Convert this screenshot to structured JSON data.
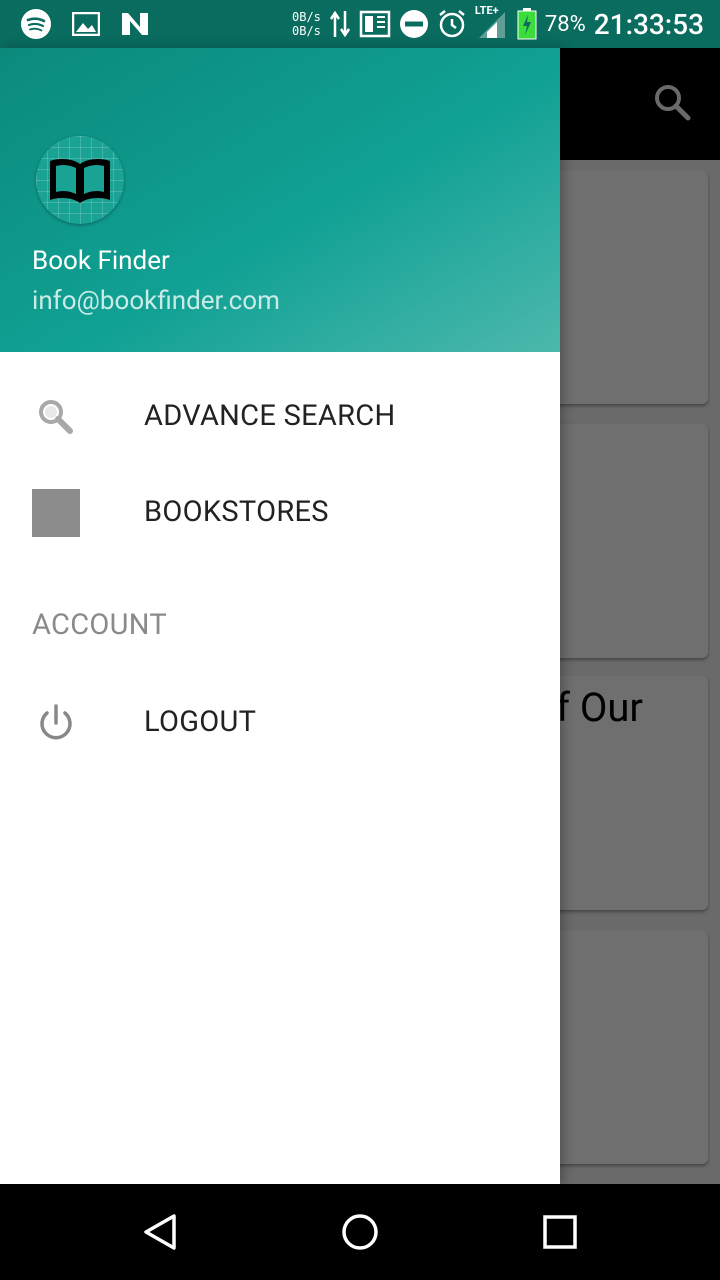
{
  "status_bar": {
    "speed_up": "0B/s",
    "speed_down": "0B/s",
    "network": "LTE+",
    "battery_pct": "78%",
    "time": "21:33:53",
    "icons": [
      "spotify-icon",
      "gallery-icon",
      "n-icon",
      "data-arrows-icon",
      "screen-icon",
      "dnd-icon",
      "alarm-icon",
      "signal-icon",
      "battery-icon"
    ]
  },
  "background": {
    "card_text": "f Our"
  },
  "drawer": {
    "header": {
      "app_name": "Book Finder",
      "email": "info@bookfinder.com",
      "colors": {
        "start": "#0b8a7c",
        "end": "#4db8ad"
      }
    },
    "items": [
      {
        "label": "ADVANCE SEARCH",
        "icon": "search-icon"
      },
      {
        "label": "BOOKSTORES",
        "icon": "placeholder-square-icon"
      }
    ],
    "section_title": "ACCOUNT",
    "account_items": [
      {
        "label": "LOGOUT",
        "icon": "power-icon"
      }
    ]
  },
  "nav_bar": {
    "buttons": [
      "back-icon",
      "home-icon",
      "recents-icon"
    ]
  }
}
